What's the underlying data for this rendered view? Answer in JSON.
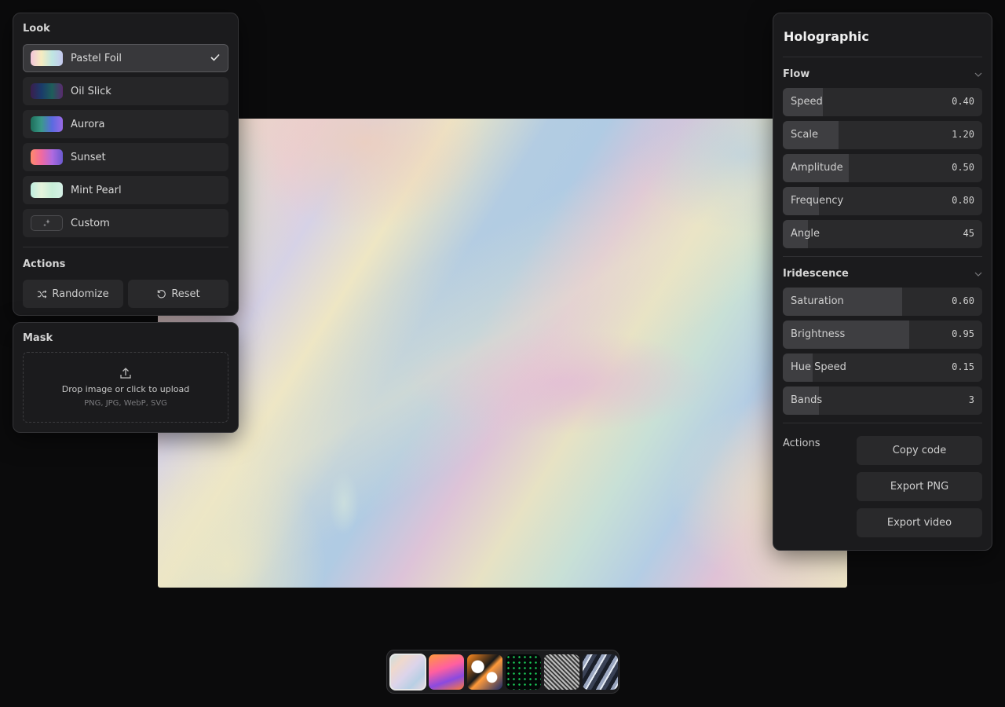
{
  "look_panel": {
    "title": "Look",
    "items": [
      {
        "label": "Pastel Foil",
        "icon": "pastel-foil-swatch"
      },
      {
        "label": "Oil Slick",
        "icon": "oil-slick-swatch"
      },
      {
        "label": "Aurora",
        "icon": "aurora-swatch"
      },
      {
        "label": "Sunset",
        "icon": "sunset-swatch"
      },
      {
        "label": "Mint Pearl",
        "icon": "mint-pearl-swatch"
      },
      {
        "label": "Custom",
        "icon": "sparkle-icon"
      }
    ],
    "selected": "Pastel Foil",
    "actions_title": "Actions",
    "randomize_label": "Randomize",
    "reset_label": "Reset"
  },
  "mask_panel": {
    "title": "Mask",
    "drop_text": "Drop image or click to upload",
    "drop_sub": "PNG, JPG, WebP, SVG"
  },
  "right_panel": {
    "title": "Holographic",
    "flow": {
      "title": "Flow",
      "sliders": [
        {
          "label": "Speed",
          "value": "0.40",
          "fill": 0.2
        },
        {
          "label": "Scale",
          "value": "1.20",
          "fill": 0.28
        },
        {
          "label": "Amplitude",
          "value": "0.50",
          "fill": 0.33
        },
        {
          "label": "Frequency",
          "value": "0.80",
          "fill": 0.18
        },
        {
          "label": "Angle",
          "value": "45",
          "fill": 0.125
        }
      ]
    },
    "iridescence": {
      "title": "Iridescence",
      "sliders": [
        {
          "label": "Saturation",
          "value": "0.60",
          "fill": 0.6
        },
        {
          "label": "Brightness",
          "value": "0.95",
          "fill": 0.635
        },
        {
          "label": "Hue Speed",
          "value": "0.15",
          "fill": 0.15
        },
        {
          "label": "Bands",
          "value": "3",
          "fill": 0.18
        }
      ]
    },
    "actions_label": "Actions",
    "copy_code": "Copy code",
    "export_png": "Export PNG",
    "export_video": "Export video"
  },
  "presets": [
    {
      "name": "pastel-foil-preset",
      "active": true
    },
    {
      "name": "sunset-blob-preset",
      "active": false
    },
    {
      "name": "liquid-metal-preset",
      "active": false
    },
    {
      "name": "matrix-dots-preset",
      "active": false
    },
    {
      "name": "noise-grain-preset",
      "active": false
    },
    {
      "name": "chrome-wave-preset",
      "active": false
    }
  ],
  "colors": {
    "background": "#0b0b0c",
    "panel": "#1b1b1d",
    "accent": "#e8e8e8"
  }
}
